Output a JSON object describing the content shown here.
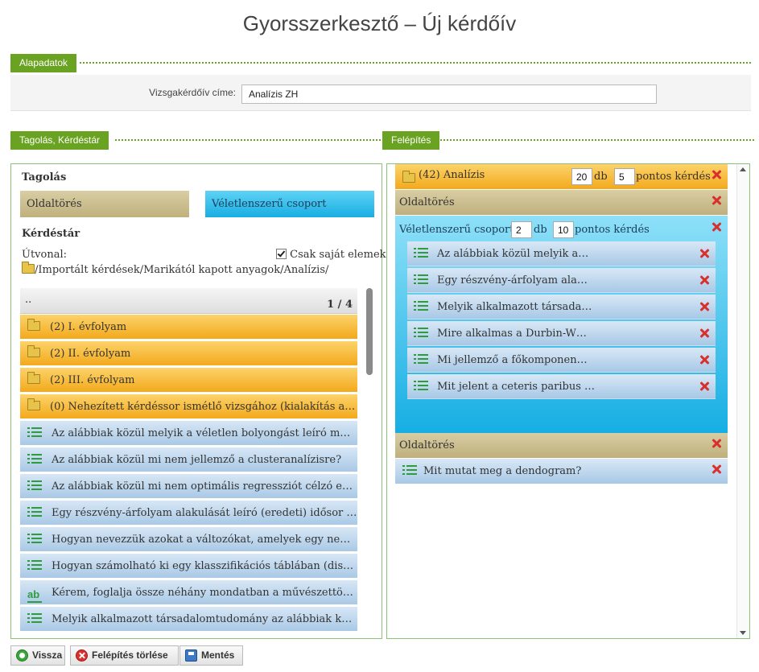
{
  "page": {
    "title": "Gyorsszerkesztő – Új kérdőív"
  },
  "basics": {
    "tab_label": "Alapadatok",
    "title_label": "Vizsgakérdőív címe:",
    "title_value": "Analízis ZH"
  },
  "left_panel": {
    "tab_label": "Tagolás, Kérdéstár",
    "tagolas_heading": "Tagolás",
    "page_break_label": "Oldaltörés",
    "random_group_label": "Véletlenszerű csoport",
    "kerdestar_heading": "Kérdéstár",
    "path_label": "Útvonal:",
    "own_items_label": "Csak saját elemek",
    "own_items_checked": true,
    "path_value": "/Importált kérdések/Marikától kapott anyagok/Analízis/",
    "list_up": "..",
    "pager": "1 / 4",
    "items": [
      {
        "type": "folder",
        "label": "(2) I. évfolyam"
      },
      {
        "type": "folder",
        "label": "(2) II. évfolyam"
      },
      {
        "type": "folder",
        "label": "(2) III. évfolyam"
      },
      {
        "type": "folder",
        "label": "(0) Nehezített kérdéssor ismétlő vizsgához (kialakítás a…"
      },
      {
        "type": "question",
        "label": "Az alábbiak közül melyik a véletlen bolyongást leíró m…"
      },
      {
        "type": "question",
        "label": "Az alábbiak közül mi nem jellemző a clusteranalízisre?"
      },
      {
        "type": "question",
        "label": "Az alábbiak közül mi nem optimális regressziót célzó e…"
      },
      {
        "type": "question",
        "label": "Egy részvény-árfolyam alakulását leíró (eredeti) idősor …"
      },
      {
        "type": "question",
        "label": "Hogyan nevezzük azokat a változókat, amelyek egy ne…"
      },
      {
        "type": "question",
        "label": "Hogyan számolható ki egy klasszifikációs táblában (dis…"
      },
      {
        "type": "text",
        "label": "Kérem, foglalja össze néhány mondatban a művészettö…"
      },
      {
        "type": "question",
        "label": "Melyik alkalmazott társadalomtudomány az alábbiak k…"
      }
    ]
  },
  "right_panel": {
    "tab_label": "Felépítés",
    "folder_block": {
      "label": "(42) Analízis",
      "count": "20",
      "db": "db",
      "points": "5",
      "points_label": "pontos kérdés"
    },
    "page_break_1": "Oldaltörés",
    "random_group": {
      "label": "Véletlenszerű csoport",
      "count": "2",
      "db": "db",
      "points": "10",
      "points_label": "pontos kérdés",
      "questions": [
        "Az alábbiak közül melyik a…",
        "Egy részvény-árfolyam ala…",
        "Melyik alkalmazott társada…",
        "Mire alkalmas a Durbin-W…",
        "Mi jellemző a főkomponen…",
        "Mit jelent a ceteris paribus …"
      ]
    },
    "page_break_2": "Oldaltörés",
    "last_question": "Mit mutat meg a dendogram?"
  },
  "buttons": {
    "back": "Vissza",
    "delete_structure": "Felépítés törlése",
    "save": "Mentés"
  },
  "colors": {
    "accent_green": "#6aa222",
    "delete_red": "#d9302e",
    "folder_orange": "#f3a91c",
    "question_blue": "#a9c9e6"
  }
}
